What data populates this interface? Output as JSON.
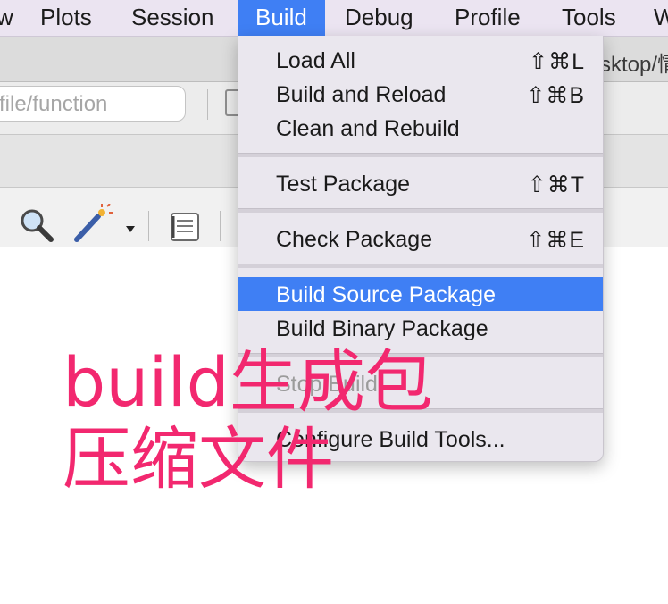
{
  "menubar": {
    "items": [
      {
        "label": "w"
      },
      {
        "label": "Plots"
      },
      {
        "label": "Session"
      },
      {
        "label": "Build"
      },
      {
        "label": "Debug"
      },
      {
        "label": "Profile"
      },
      {
        "label": "Tools"
      },
      {
        "label": "W"
      }
    ]
  },
  "window": {
    "path_fragment": "sktop/情"
  },
  "search": {
    "placeholder": "file/function"
  },
  "build_menu": {
    "items": [
      {
        "label": "Load All",
        "shortcut": "⇧⌘L"
      },
      {
        "label": "Build and Reload",
        "shortcut": "⇧⌘B"
      },
      {
        "label": "Clean and Rebuild",
        "shortcut": ""
      },
      {
        "label": "Test Package",
        "shortcut": "⇧⌘T"
      },
      {
        "label": "Check Package",
        "shortcut": "⇧⌘E"
      },
      {
        "label": "Build Source Package",
        "shortcut": ""
      },
      {
        "label": "Build Binary Package",
        "shortcut": ""
      },
      {
        "label": "Stop Build",
        "shortcut": ""
      },
      {
        "label": "Configure Build Tools...",
        "shortcut": ""
      }
    ],
    "highlighted": "Build Source Package"
  },
  "annotation": {
    "line1": "build生成包",
    "line2": "压缩文件",
    "color": "#f2286f"
  },
  "colors": {
    "accent": "#3f7ff4",
    "menubar_bg": "#ebe4f1"
  }
}
